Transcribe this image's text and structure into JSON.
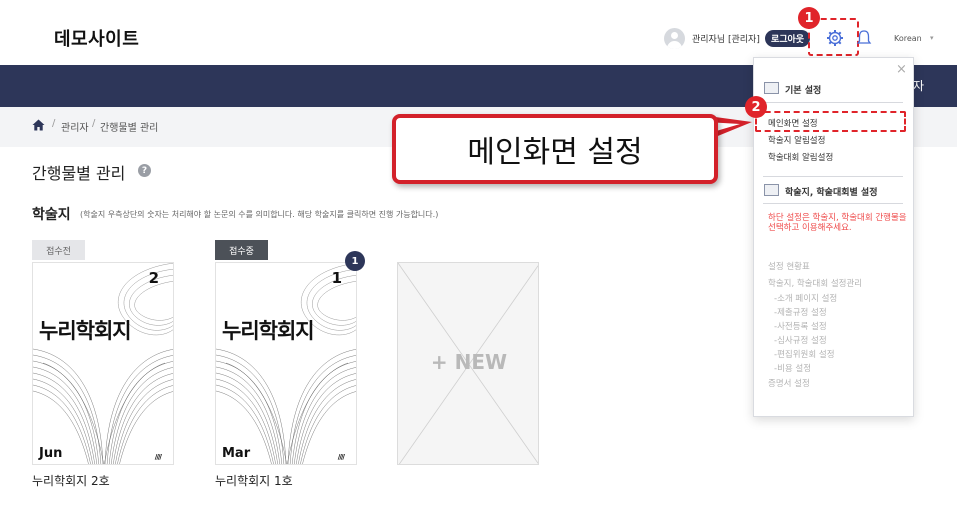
{
  "header": {
    "site_title": "데모사이트",
    "user_name": "관리자님 [관리자]",
    "logout_label": "로그아웃",
    "language": "Korean",
    "language_caret": "▾"
  },
  "nav": {
    "visible_text": "자"
  },
  "breadcrumb": {
    "items": [
      "관리자",
      "간행물별 관리"
    ],
    "separator": "/"
  },
  "page": {
    "title": "간행물별 관리",
    "help": "?",
    "section_title": "학술지",
    "section_desc": "(학술지 우측상단의 숫자는 처리해야 할 논문의 수를 의미합니다. 해당 학술지를 클릭하면 진행 가능합니다.)"
  },
  "journals": [
    {
      "status": "접수전",
      "cover_title": "누리학회지",
      "issue": "2",
      "month": "Jun",
      "marks": "////",
      "label": "누리학회지 2호"
    },
    {
      "status": "접수중",
      "cover_title": "누리학회지",
      "issue": "1",
      "month": "Mar",
      "marks": "////",
      "label": "누리학회지 1호",
      "pending_count": "1"
    }
  ],
  "new_card": {
    "label": "+ NEW"
  },
  "settings_menu": {
    "close": "×",
    "basic_header": "기본 설정",
    "basic_items": [
      "메인화면 설정",
      "학술지 알림설정",
      "학술대회 알림설정"
    ],
    "journal_header": "학술지, 학술대회별 설정",
    "warning": "하단 설정은 학술지, 학술대회 간행물을 선택하고 이용해주세요.",
    "sub_items": [
      "설정 현황표",
      "학술지, 학술대회 설정관리",
      "-소개 페이지 설정",
      "-제출규정 설정",
      "-사전등록 설정",
      "-심사규정 설정",
      "-편집위원회 설정",
      "-비용 설정",
      "증명서 설정"
    ]
  },
  "annotations": {
    "step1": "1",
    "step2": "2",
    "callout": "메인화면 설정"
  },
  "colors": {
    "navbar": "#2d3659",
    "highlight": "#e0242a",
    "warning": "#ef4b4b"
  }
}
